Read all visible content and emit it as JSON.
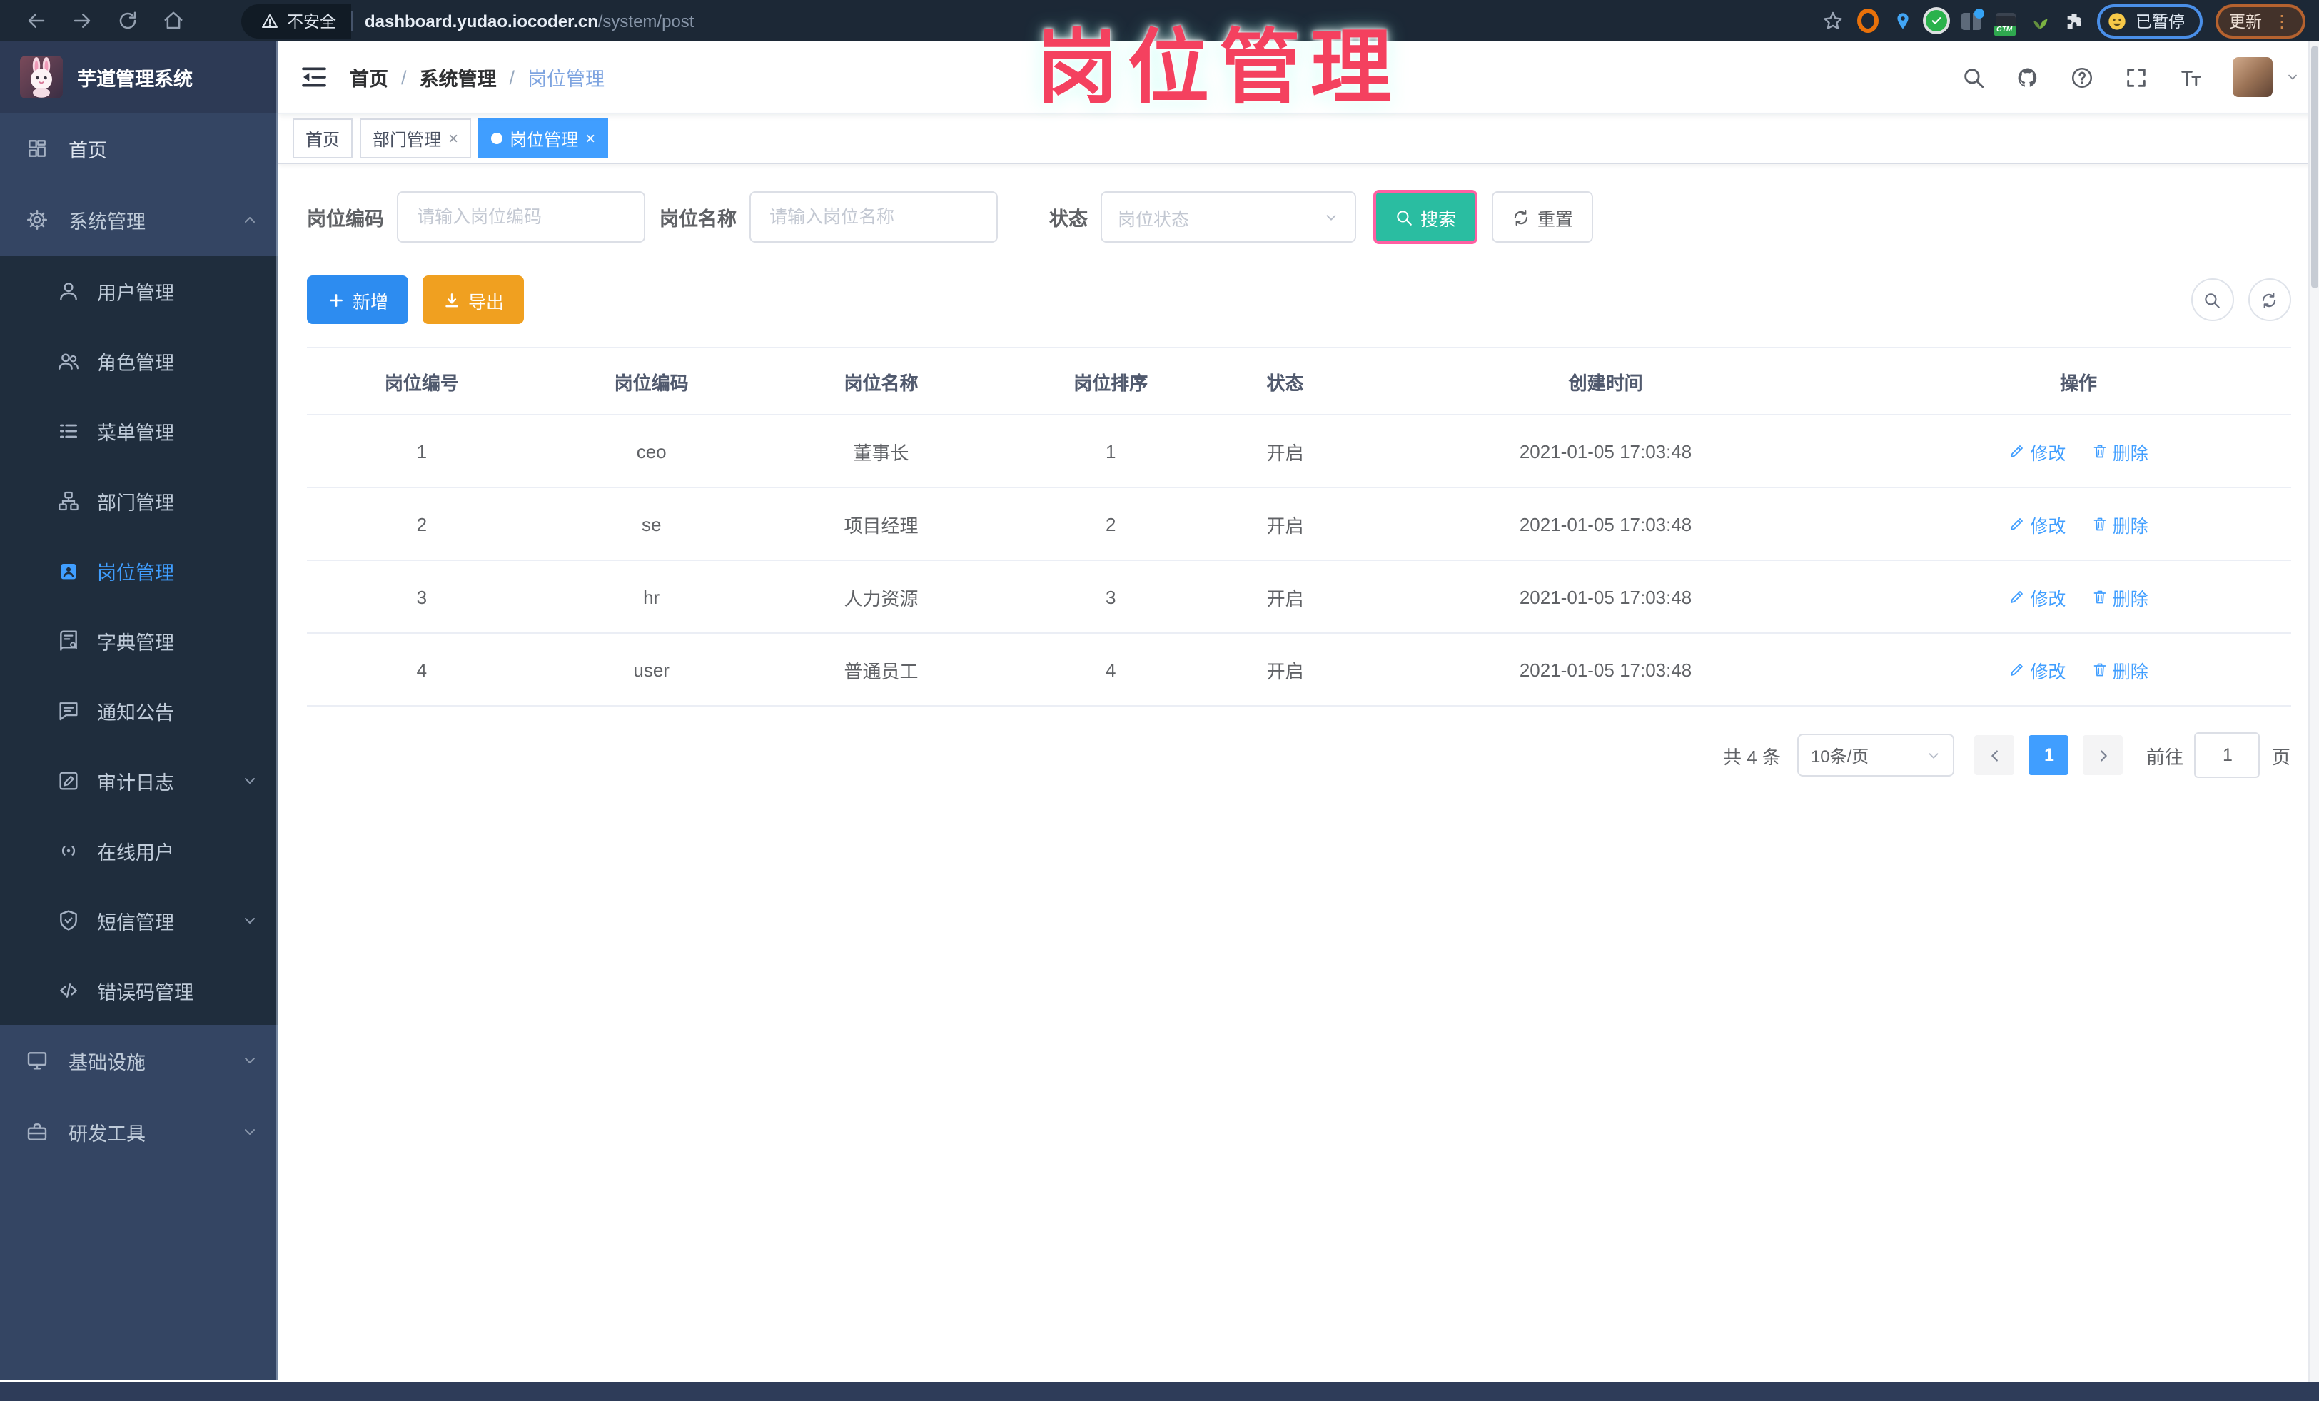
{
  "browser": {
    "security_label": "不安全",
    "url_host": "dashboard.yudao.iocoder.cn",
    "url_path": "/system/post",
    "paused_label": "已暂停",
    "update_label": "更新"
  },
  "overlay": {
    "text": "岗位管理"
  },
  "sidebar": {
    "logo_title": "芋道管理系统",
    "home": "首页",
    "system": "系统管理",
    "sub": [
      "用户管理",
      "角色管理",
      "菜单管理",
      "部门管理",
      "岗位管理",
      "字典管理",
      "通知公告",
      "审计日志",
      "在线用户",
      "短信管理",
      "错误码管理"
    ],
    "infra": "基础设施",
    "devtools": "研发工具"
  },
  "breadcrumb": [
    "首页",
    "系统管理",
    "岗位管理"
  ],
  "tabs": [
    {
      "label": "首页"
    },
    {
      "label": "部门管理"
    },
    {
      "label": "岗位管理"
    }
  ],
  "filters": {
    "code_label": "岗位编码",
    "code_placeholder": "请输入岗位编码",
    "name_label": "岗位名称",
    "name_placeholder": "请输入岗位名称",
    "status_label": "状态",
    "status_placeholder": "岗位状态",
    "search_label": "搜索",
    "reset_label": "重置"
  },
  "toolbar": {
    "add_label": "新增",
    "export_label": "导出"
  },
  "table": {
    "columns": [
      "岗位编号",
      "岗位编码",
      "岗位名称",
      "岗位排序",
      "状态",
      "创建时间",
      "操作"
    ],
    "edit_label": "修改",
    "delete_label": "删除",
    "rows": [
      {
        "id": "1",
        "code": "ceo",
        "name": "董事长",
        "sort": "1",
        "status": "开启",
        "created": "2021-01-05 17:03:48"
      },
      {
        "id": "2",
        "code": "se",
        "name": "项目经理",
        "sort": "2",
        "status": "开启",
        "created": "2021-01-05 17:03:48"
      },
      {
        "id": "3",
        "code": "hr",
        "name": "人力资源",
        "sort": "3",
        "status": "开启",
        "created": "2021-01-05 17:03:48"
      },
      {
        "id": "4",
        "code": "user",
        "name": "普通员工",
        "sort": "4",
        "status": "开启",
        "created": "2021-01-05 17:03:48"
      }
    ]
  },
  "pagination": {
    "total": "共 4 条",
    "page_size": "10条/页",
    "current": "1",
    "goto_label": "前往",
    "goto_value": "1",
    "unit_label": "页"
  },
  "colors": {
    "accent": "#409eff",
    "search_button": "#2abda1",
    "add_button": "#2d8cf0",
    "export_button": "#f0a020",
    "overlay_pink": "#f4415f",
    "sidebar_bg": "#344563",
    "submenu_bg": "#1f2d3d"
  }
}
